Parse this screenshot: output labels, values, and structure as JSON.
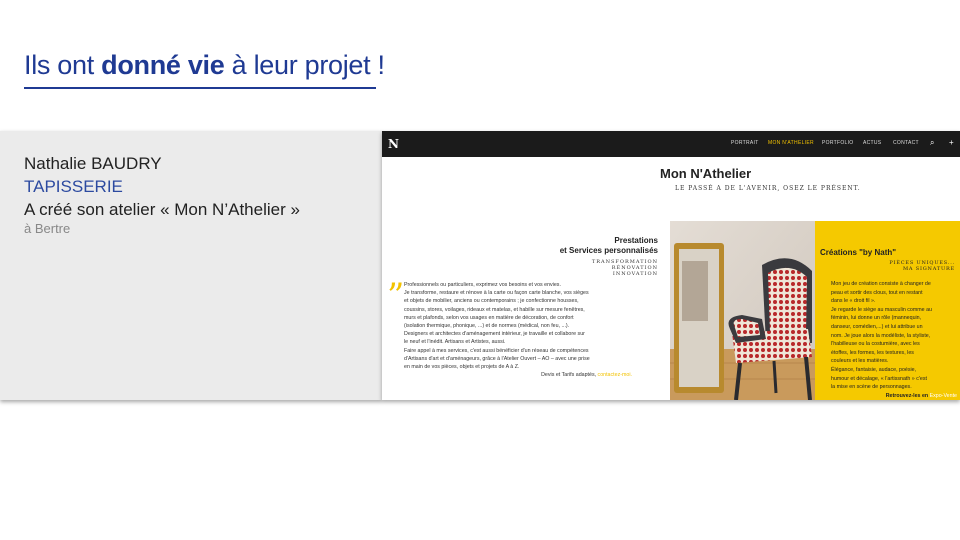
{
  "slide": {
    "title_pre": "Ils ont ",
    "title_bold": "donné vie",
    "title_post": " à leur projet !"
  },
  "profile": {
    "name": "Nathalie BAUDRY",
    "trade": "TAPISSERIE",
    "description": "A créé son atelier « Mon N’Athelier »",
    "location": "à Bertre"
  },
  "website": {
    "logo": "N",
    "nav": [
      "PORTRAIT",
      "MON N'ATHELIER",
      "PORTFOLIO",
      "ACTUS",
      "CONTACT"
    ],
    "nav_active": "MON N'ATHELIER",
    "search_icon": "⌕",
    "plus_icon": "+",
    "title": "Mon N'Athelier",
    "tagline": "LE PASSÉ A DE L'AVENIR, OSEZ LE PRÉSENT.",
    "services": {
      "title_line1": "Prestations",
      "title_line2": "et Services personnalisés",
      "subtitles": [
        "TRANSFORMATION",
        "RÉNOVATION",
        "INNOVATION"
      ],
      "quote_mark": "”",
      "lines": [
        "Professionnels ou particuliers, exprimez vos besoins et vos envies.",
        "Je transforme, restaure et rénove à la carte ou façon carte blanche, vos sièges",
        "et objets de mobilier, anciens ou contemporains ; je confectionne housses,",
        "coussins, stores, voilages, rideaux et matelas, et habille sur mesure fenêtres,",
        "murs et plafonds, selon vos usages en matière de décoration, de confort",
        "(isolation thermique, phonique, ...) et de normes (médical, non feu, ...).",
        "Designers et architectes d'aménagement intérieur, je travaille et collabore sur",
        "le neuf et l'inédit. Artisans et Artistes, aussi.",
        "Faire appel à mes services, c'est aussi bénéficier d'un réseau de compétences",
        "d'Artisans d'art et d'aménageurs, grâce à l'Atelier Ouvert – AO – avec une prise",
        "en main de vos pièces, objets et projets de A à Z."
      ],
      "footer_text": "Devis et Tarifs adaptés, ",
      "footer_link": "contactez-moi."
    },
    "creations": {
      "title": "Créations \"by Nath\"",
      "subtitles": [
        "PIÈCES UNIQUES...",
        "MA SIGNATURE"
      ],
      "lines": [
        "Mon jeu de création consiste à changer de",
        "peau et sortir des clous, tout en restant",
        "dans le « droit fil ».",
        "Je regarde le siège au masculin comme au",
        "féminin, lui donne un rôle (mannequin,",
        "danseur, comédien,...) et lui attribue un",
        "nom. Je joue alors la modéliste, la styliste,",
        "l'habilleuse ou la costumière, avec les",
        "étoffes, les formes, les textures, les",
        "couleurs et les matières.",
        "Élégance, fantaisie, audace, poésie,",
        "humour et décalage, « l'artissnath » c'est",
        "la mise en scène de personnages."
      ],
      "footer_text": "Retrouvez-les en ",
      "footer_link": "Expo-Vente"
    }
  },
  "colors": {
    "title_blue": "#1f3a93",
    "accent_yellow": "#f5c900",
    "nav_bg": "#1b1b1b"
  }
}
